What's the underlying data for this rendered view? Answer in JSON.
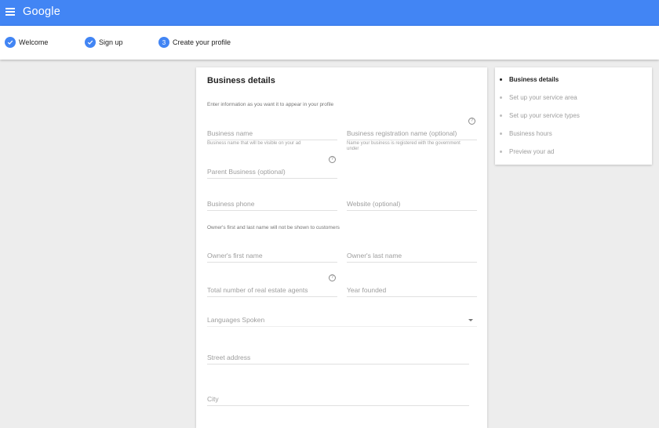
{
  "header": {
    "logo": "Google"
  },
  "stepper": {
    "steps": [
      {
        "label": "Welcome",
        "state": "done"
      },
      {
        "label": "Sign up",
        "state": "done"
      },
      {
        "label": "Create your profile",
        "state": "current",
        "number": "3"
      }
    ]
  },
  "form": {
    "title": "Business details",
    "intro": "Enter information as you want it to appear in your profile",
    "business_name": {
      "placeholder": "Business name",
      "helper": "Business name that will be visible on your ad"
    },
    "registration_name": {
      "placeholder": "Business registration name (optional)",
      "helper": "Name your business is registered with the government under"
    },
    "parent_business": {
      "placeholder": "Parent Business (optional)"
    },
    "business_phone": {
      "placeholder": "Business phone"
    },
    "website": {
      "placeholder": "Website (optional)"
    },
    "owner_note": "Owner's first and last name will not be shown to customers",
    "owner_first": {
      "placeholder": "Owner's first name"
    },
    "owner_last": {
      "placeholder": "Owner's last name"
    },
    "agents": {
      "placeholder": "Total number of real estate agents"
    },
    "year_founded": {
      "placeholder": "Year founded"
    },
    "languages": {
      "placeholder": "Languages Spoken"
    },
    "street": {
      "placeholder": "Street address"
    },
    "city": {
      "placeholder": "City"
    },
    "help_glyph": "?"
  },
  "sidebar": {
    "items": [
      {
        "label": "Business details",
        "active": true
      },
      {
        "label": "Set up your service area",
        "active": false
      },
      {
        "label": "Set up your service types",
        "active": false
      },
      {
        "label": "Business hours",
        "active": false
      },
      {
        "label": "Preview your ad",
        "active": false
      }
    ]
  },
  "colors": {
    "primary": "#4285f4",
    "background": "#ededed"
  }
}
